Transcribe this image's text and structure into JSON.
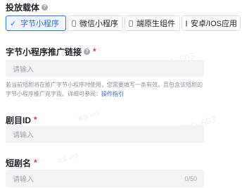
{
  "delivery": {
    "label": "投放载体",
    "help": "?",
    "options": [
      {
        "label": "字节小程序",
        "selected": true,
        "icon": "check-icon"
      },
      {
        "label": "微信小程序",
        "selected": false
      },
      {
        "label": "端原生组件",
        "selected": false
      },
      {
        "label": "安卓/IOS应用",
        "selected": false
      }
    ]
  },
  "link": {
    "label": "字节小程序推广链接",
    "help": "?",
    "required": "*",
    "placeholder": "请输入",
    "hint": "若当前短剧将在推广字节小程序时使用，您需要填写一条有效、且包含该短剧的字节小程序推广充字段。详细可参阅：",
    "hint_link": "操作指引"
  },
  "drama_id": {
    "label": "剧目ID",
    "required": "*",
    "placeholder": "请输入"
  },
  "drama_name": {
    "label": "短剧名",
    "required": "*",
    "placeholder": "请输入",
    "counter": "0/50"
  },
  "watermark": {
    "big": "帮助中心-603",
    "small": "赛事 603"
  }
}
